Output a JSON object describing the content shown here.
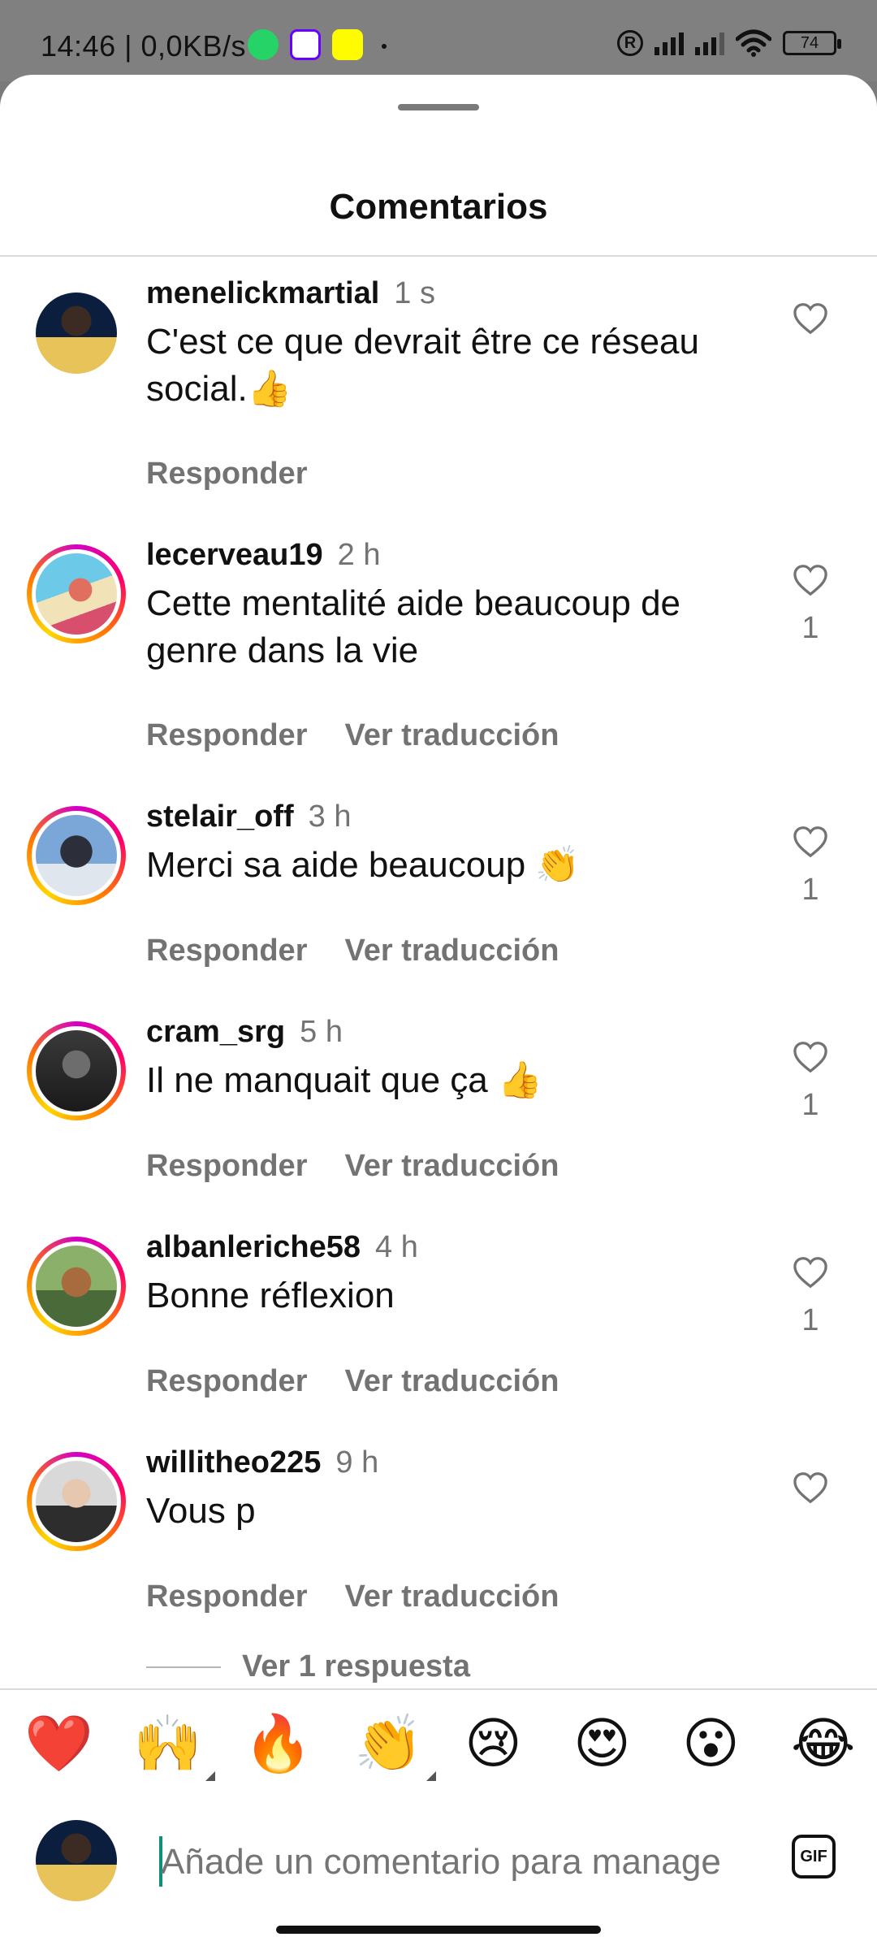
{
  "status_bar": {
    "time": "14:46 | 0,0KB/s",
    "battery": "74"
  },
  "sheet": {
    "title": "Comentarios"
  },
  "comments": [
    {
      "username": "menelickmartial",
      "time": "1 s",
      "text": "C'est ce que devrait être ce réseau social.👍",
      "actions": [
        "Responder"
      ],
      "likes": "",
      "avatar_colors": [
        "#0b1e3d",
        "#e8c35a"
      ]
    },
    {
      "username": "lecerveau19",
      "time": "2 h",
      "text": "Cette mentalité aide beaucoup de genre dans la vie",
      "actions": [
        "Responder",
        "Ver traducción"
      ],
      "likes": "1",
      "avatar_colors": [
        "#6cc9e8",
        "#e06f5f"
      ]
    },
    {
      "username": "stelair_off",
      "time": "3 h",
      "text": "Merci sa aide beaucoup 👏",
      "actions": [
        "Responder",
        "Ver traducción"
      ],
      "likes": "1",
      "avatar_colors": [
        "#7aa6d8",
        "#2c2f3a"
      ]
    },
    {
      "username": "cram_srg",
      "time": "5 h",
      "text": "Il ne manquait que ça 👍",
      "actions": [
        "Responder",
        "Ver traducción"
      ],
      "likes": "1",
      "avatar_colors": [
        "#1a1a1a",
        "#6d6d6d"
      ]
    },
    {
      "username": "albanleriche58",
      "time": "4 h",
      "text": "Bonne réflexion",
      "actions": [
        "Responder",
        "Ver traducción"
      ],
      "likes": "1",
      "avatar_colors": [
        "#4b6a3a",
        "#a86b3d"
      ]
    },
    {
      "username": "willitheo225",
      "time": "9 h",
      "text": "Vous p",
      "actions": [
        "Responder",
        "Ver traducción"
      ],
      "likes": "",
      "avatar_colors": [
        "#d9d9d9",
        "#2d2d2d"
      ]
    }
  ],
  "replies_link": "Ver 1 respuesta",
  "emoji_bar": [
    "❤️",
    "🙌",
    "🔥",
    "👏",
    "😢",
    "😍",
    "😮",
    "😂"
  ],
  "composer": {
    "placeholder": "Añade un comentario para manage",
    "gif_label": "GIF"
  }
}
